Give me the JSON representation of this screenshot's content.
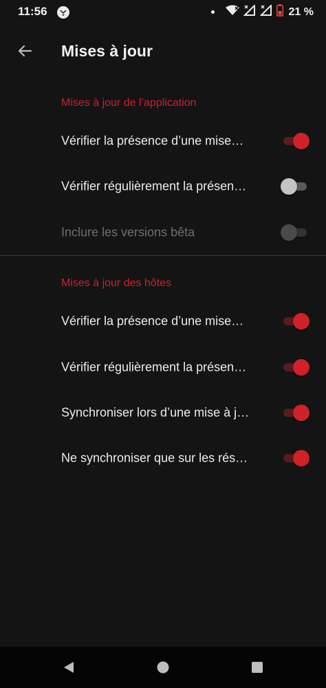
{
  "status_bar": {
    "time": "11:56",
    "battery_text": "21 %",
    "icons": [
      "shield-app-icon",
      "dot-icon",
      "wifi-icon",
      "signal-icon",
      "signal-icon",
      "battery-icon"
    ]
  },
  "app_bar": {
    "title": "Mises à jour",
    "back_icon": "arrow-left-icon"
  },
  "sections": [
    {
      "header": "Mises à jour de l’application",
      "items": [
        {
          "label": "Vérifier la présence d’une mise…",
          "checked": true,
          "enabled": true
        },
        {
          "label": "Vérifier régulièrement la présen…",
          "checked": false,
          "enabled": true
        },
        {
          "label": "Inclure les versions bêta",
          "checked": false,
          "enabled": false
        }
      ]
    },
    {
      "header": "Mises à jour des hôtes",
      "items": [
        {
          "label": "Vérifier la présence d’une mise…",
          "checked": true,
          "enabled": true
        },
        {
          "label": "Vérifier régulièrement la présen…",
          "checked": true,
          "enabled": true
        },
        {
          "label": "Synchroniser lors d’une mise à j…",
          "checked": true,
          "enabled": true
        },
        {
          "label": "Ne synchroniser que sur les rés…",
          "checked": true,
          "enabled": true
        }
      ]
    }
  ],
  "colors": {
    "background": "#141414",
    "accent": "#cf2128",
    "section_header": "#c8222b",
    "text": "#ececec",
    "disabled_text": "#6e6e6e"
  },
  "nav_bar": {
    "icons": [
      "back-triangle-icon",
      "home-circle-icon",
      "recents-square-icon"
    ]
  }
}
